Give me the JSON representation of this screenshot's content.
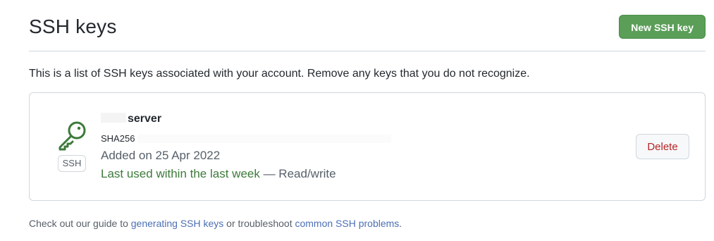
{
  "header": {
    "title": "SSH keys",
    "new_key_label": "New SSH key"
  },
  "intro": "This is a list of SSH keys associated with your account. Remove any keys that you do not recognize.",
  "key": {
    "title_suffix": "server",
    "fingerprint_prefix": "SHA256",
    "added_on": "Added on 25 Apr 2022",
    "last_used": "Last used within the last week",
    "access": " — Read/write",
    "type_label": "SSH",
    "delete_label": "Delete"
  },
  "footer": {
    "text_before": "Check out our guide to ",
    "link1": "generating SSH keys",
    "text_middle": " or troubleshoot ",
    "link2": "common SSH problems",
    "text_after": "."
  },
  "colors": {
    "primary_button": "#5a9e58",
    "key_icon": "#3d7a3b",
    "link": "#4c6fb5",
    "danger": "#b62324"
  }
}
